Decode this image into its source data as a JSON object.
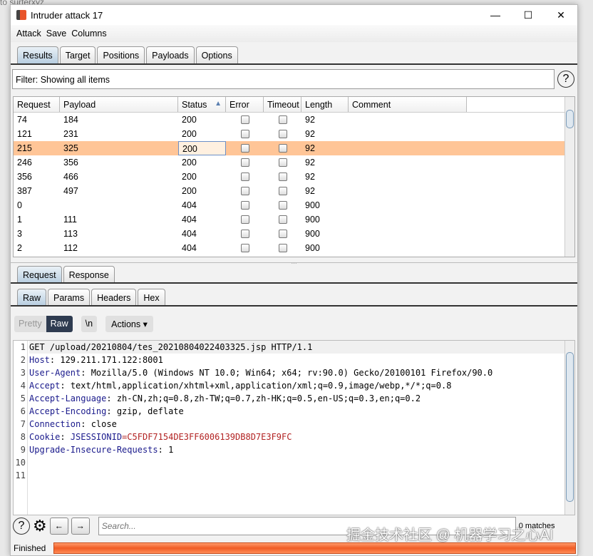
{
  "background": {
    "text": "to surferxyz"
  },
  "window": {
    "title": "Intruder attack 17",
    "minimize": "—",
    "maximize": "☐",
    "close": "✕"
  },
  "menu": [
    "Attack",
    "Save",
    "Columns"
  ],
  "tabs": [
    "Results",
    "Target",
    "Positions",
    "Payloads",
    "Options"
  ],
  "filter": {
    "text": "Filter: Showing all items",
    "help": "?"
  },
  "table": {
    "columns": [
      "Request",
      "Payload",
      "Status",
      "Error",
      "Timeout",
      "Length",
      "Comment"
    ],
    "sort_indicator": "▲",
    "selected_row": 2,
    "rows": [
      [
        "74",
        "184",
        "200",
        "92"
      ],
      [
        "121",
        "231",
        "200",
        "92"
      ],
      [
        "215",
        "325",
        "200",
        "92"
      ],
      [
        "246",
        "356",
        "200",
        "92"
      ],
      [
        "356",
        "466",
        "200",
        "92"
      ],
      [
        "387",
        "497",
        "200",
        "92"
      ],
      [
        "0",
        "",
        "404",
        "900"
      ],
      [
        "1",
        "111",
        "404",
        "900"
      ],
      [
        "3",
        "113",
        "404",
        "900"
      ],
      [
        "2",
        "112",
        "404",
        "900"
      ]
    ]
  },
  "msg_tabs": [
    "Request",
    "Response"
  ],
  "view_tabs": [
    "Raw",
    "Params",
    "Headers",
    "Hex"
  ],
  "editor_toolbar": {
    "pretty": "Pretty",
    "raw": "Raw",
    "newline": "\\n",
    "actions": "Actions ▾"
  },
  "request_lines": [
    {
      "k": "",
      "v": "GET /upload/20210804/tes_20210804022403325.jsp HTTP/1.1"
    },
    {
      "k": "Host",
      "v": "129.211.171.122:8001"
    },
    {
      "k": "User-Agent",
      "v": "Mozilla/5.0 (Windows NT 10.0; Win64; x64; rv:90.0) Gecko/20100101 Firefox/90.0"
    },
    {
      "k": "Accept",
      "v": "text/html,application/xhtml+xml,application/xml;q=0.9,image/webp,*/*;q=0.8"
    },
    {
      "k": "Accept-Language",
      "v": "zh-CN,zh;q=0.8,zh-TW;q=0.7,zh-HK;q=0.5,en-US;q=0.3,en;q=0.2"
    },
    {
      "k": "Accept-Encoding",
      "v": "gzip, deflate"
    },
    {
      "k": "Connection",
      "v": "close"
    },
    {
      "k": "Cookie",
      "v": "",
      "ck": "JSESSIONID",
      "cv": "C5FDF7154DE3FF6006139DB8D7E3F9FC"
    },
    {
      "k": "Upgrade-Insecure-Requests",
      "v": "1"
    },
    {
      "k": "",
      "v": ""
    },
    {
      "k": "",
      "v": ""
    }
  ],
  "search": {
    "placeholder": "Search...",
    "matches": "0 matches"
  },
  "status": {
    "text": "Finished",
    "progress_percent": 100
  },
  "watermark": "掘金技术社区 @ 机器学习之心AI",
  "colors": {
    "selected_row": "#ffc597",
    "progress": "#f05d25",
    "header_key": "#1a1a8c",
    "cookie_value": "#b22222"
  }
}
